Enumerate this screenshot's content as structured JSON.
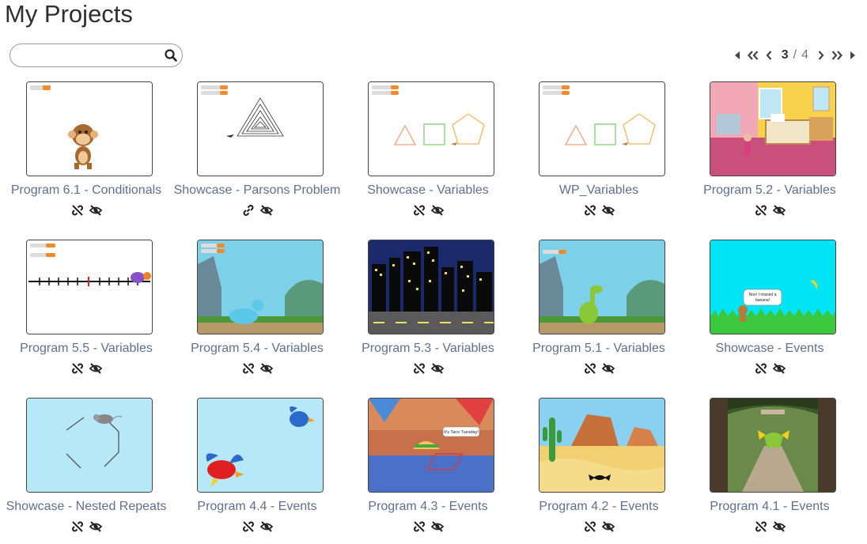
{
  "header": {
    "title": "My Projects"
  },
  "search": {
    "placeholder": "",
    "value": ""
  },
  "pagination": {
    "current": "3",
    "separator": "/",
    "total": "4"
  },
  "colors": {
    "title_text": "#5f6f8e",
    "sky_light": "#b7e8f7",
    "cyan": "#00e5f5"
  },
  "projects": [
    {
      "title": "Program 6.1 - Conditionals",
      "link_icon": "unlink-icon",
      "visibility_icon": "eye-slash-icon"
    },
    {
      "title": "Showcase - Parsons Problem",
      "link_icon": "link-icon",
      "visibility_icon": "eye-slash-icon"
    },
    {
      "title": "Showcase - Variables",
      "link_icon": "unlink-icon",
      "visibility_icon": "eye-slash-icon"
    },
    {
      "title": "WP_Variables",
      "link_icon": "unlink-icon",
      "visibility_icon": "eye-slash-icon"
    },
    {
      "title": "Program 5.2 - Variables",
      "link_icon": "unlink-icon",
      "visibility_icon": "eye-slash-icon"
    },
    {
      "title": "Program 5.5 - Variables",
      "link_icon": "unlink-icon",
      "visibility_icon": "eye-slash-icon"
    },
    {
      "title": "Program 5.4 - Variables",
      "link_icon": "unlink-icon",
      "visibility_icon": "eye-slash-icon"
    },
    {
      "title": "Program 5.3 - Variables",
      "link_icon": "unlink-icon",
      "visibility_icon": "eye-slash-icon"
    },
    {
      "title": "Program 5.1 - Variables",
      "link_icon": "unlink-icon",
      "visibility_icon": "eye-slash-icon"
    },
    {
      "title": "Showcase - Events",
      "link_icon": "unlink-icon",
      "visibility_icon": "eye-slash-icon"
    },
    {
      "title": "Showcase - Nested Repeats",
      "link_icon": "unlink-icon",
      "visibility_icon": "eye-slash-icon"
    },
    {
      "title": "Program 4.4 - Events",
      "link_icon": "unlink-icon",
      "visibility_icon": "eye-slash-icon"
    },
    {
      "title": "Program 4.3 - Events",
      "link_icon": "unlink-icon",
      "visibility_icon": "eye-slash-icon"
    },
    {
      "title": "Program 4.2 - Events",
      "link_icon": "unlink-icon",
      "visibility_icon": "eye-slash-icon"
    },
    {
      "title": "Program 4.1 - Events",
      "link_icon": "unlink-icon",
      "visibility_icon": "eye-slash-icon"
    }
  ],
  "thumb_texts": {
    "speech_events": "Noo! I missed a banana!",
    "speech_taco": "It's Taco Tuesday!"
  }
}
